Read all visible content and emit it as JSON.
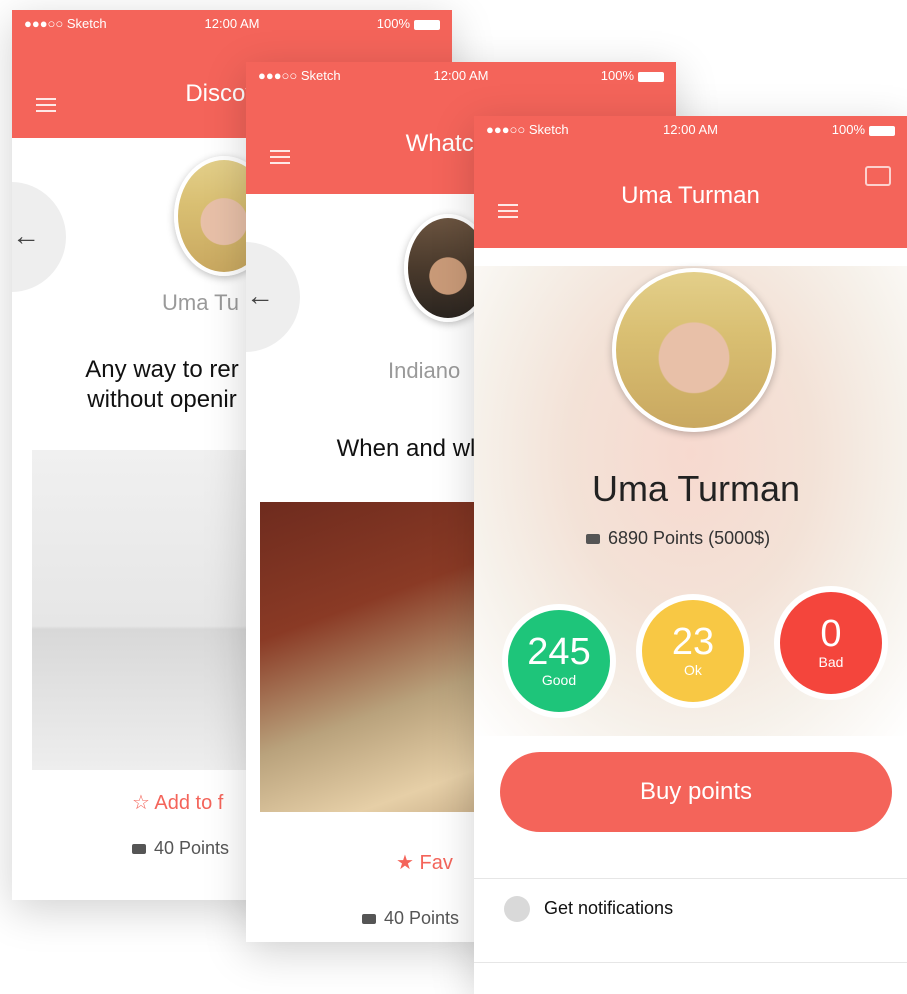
{
  "status": {
    "carrier": "●●●○○ Sketch",
    "time": "12:00 AM",
    "battery": "100%"
  },
  "discover": {
    "title": "Discover",
    "user_name": "Uma Tu",
    "question": "Any way to rer without openir",
    "favorite_label": "Add to f",
    "points": "40 Points"
  },
  "watchlist": {
    "title": "Whatchlist",
    "user_name": "Indiano",
    "question": "When and wl",
    "favorite_label": "Fav",
    "points": "40 Points"
  },
  "profile": {
    "title": "Uma Turman",
    "name": "Uma Turman",
    "points_line": "6890 Points  (5000$)",
    "stats": [
      {
        "value": "245",
        "label": "Good",
        "color": "#1ec57a"
      },
      {
        "value": "23",
        "label": "Ok",
        "color": "#f8c844"
      },
      {
        "value": "0",
        "label": "Bad",
        "color": "#f4453c"
      }
    ],
    "buy_button": "Buy points",
    "notifications_label": "Get notifications"
  },
  "colors": {
    "accent": "#f4645a"
  },
  "icons": [
    "menu-icon",
    "back-arrow-icon",
    "star-icon",
    "tag-icon",
    "price-tag-icon",
    "toggle-icon"
  ]
}
